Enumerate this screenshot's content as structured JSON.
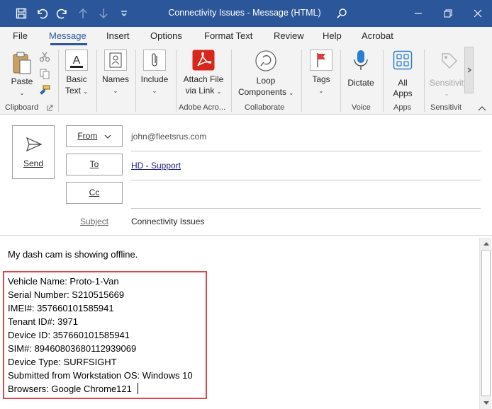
{
  "window": {
    "title": "Connectivity Issues  -  Message (HTML)"
  },
  "tabs": [
    "File",
    "Message",
    "Insert",
    "Options",
    "Format Text",
    "Review",
    "Help",
    "Acrobat"
  ],
  "active_tab": "Message",
  "ribbon": {
    "clipboard": {
      "paste": "Paste",
      "group": "Clipboard"
    },
    "basic_text": {
      "line1": "Basic",
      "line2": "Text"
    },
    "names": {
      "label": "Names"
    },
    "include": {
      "label": "Include"
    },
    "adobe": {
      "line1": "Attach File",
      "line2": "via Link",
      "group": "Adobe Acro..."
    },
    "collab": {
      "line1": "Loop",
      "line2": "Components",
      "group": "Collaborate"
    },
    "tags": {
      "label": "Tags"
    },
    "voice": {
      "label": "Dictate",
      "group": "Voice"
    },
    "apps": {
      "line1": "All",
      "line2": "Apps",
      "group": "Apps"
    },
    "sensitivity": {
      "label": "Sensitivity",
      "group": "Sensitivit"
    }
  },
  "compose": {
    "send_label": "Send",
    "from_label": "From",
    "from_value": "john@fleetsrus.com",
    "to_label": "To",
    "to_value": "HD -  Support",
    "cc_label": "Cc",
    "cc_value": "",
    "subject_label": "Subject",
    "subject_value": "Connectivity Issues"
  },
  "body": {
    "intro": "My dash cam is showing offline.",
    "details": [
      "Vehicle Name: Proto-1-Van",
      "Serial Number: S210515669",
      "IMEI#: 357660101585941",
      "Tenant ID#: 3971",
      "Device ID: 357660101585941",
      "SIM#: 89460803680112939069",
      "Device Type: SURFSIGHT",
      "Submitted from Workstation OS: Windows 10",
      "Browsers: Google Chrome121"
    ]
  },
  "colors": {
    "titlebar": "#2b579a",
    "highlight": "#e0474c",
    "acrobat_red": "#d9261c",
    "voice_blue": "#2b7cd3"
  }
}
